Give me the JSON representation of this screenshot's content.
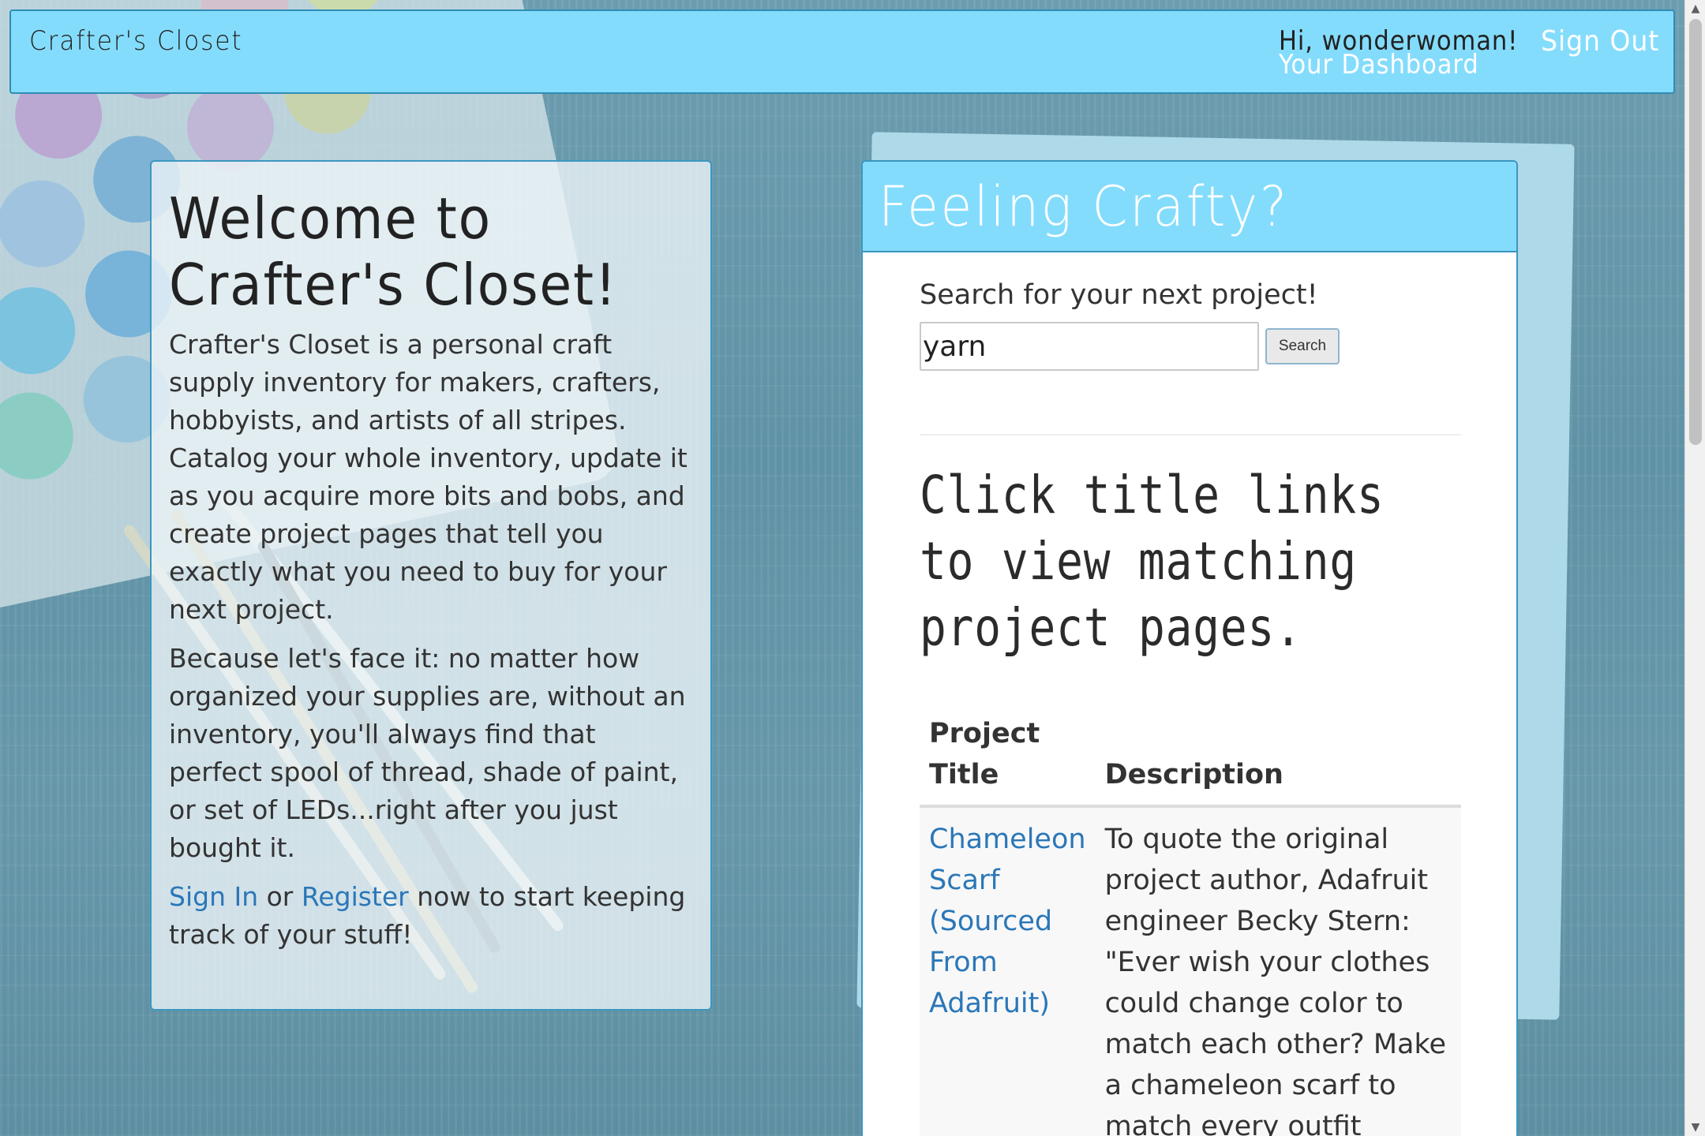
{
  "navbar": {
    "brand": "Crafter's Closet",
    "greeting": "Hi, wonderwoman!",
    "dashboard_link": "Your Dashboard",
    "signout_link": "Sign Out"
  },
  "welcome": {
    "title": "Welcome to Crafter's Closet!",
    "para1": "Crafter's Closet is a personal craft supply inventory for makers, crafters, hobbyists, and artists of all stripes. Catalog your whole inventory, update it as you acquire more bits and bobs, and create project pages that tell you exactly what you need to buy for your next project.",
    "para2": "Because let's face it: no matter how organized your supplies are, without an inventory, you'll always find that perfect spool of thread, shade of paint, or set of LEDs...right after you just bought it.",
    "signin_link": "Sign In",
    "or_text": " or ",
    "register_link": "Register",
    "cta_tail": " now to start keeping track of your stuff!"
  },
  "crafty": {
    "header": "Feeling Crafty?",
    "search_label": "Search for your next project!",
    "search_value": "yarn",
    "search_button": "Search",
    "instructions": "Click title links to view matching project pages.",
    "table": {
      "col_title": "Project Title",
      "col_description": "Description",
      "rows": [
        {
          "title": "Chameleon Scarf (Sourced From Adafruit)",
          "description": "To quote the original project author, Adafruit engineer Becky Stern: \"Ever wish your clothes could change color to match each other? Make a chameleon scarf to match every outfit"
        }
      ]
    }
  },
  "colors": {
    "accent": "#84dcfc",
    "border": "#3b97c0",
    "link": "#2a77b8"
  },
  "icons": {
    "scroll_up": "triangle-up-icon",
    "scroll_down": "triangle-down-icon"
  }
}
